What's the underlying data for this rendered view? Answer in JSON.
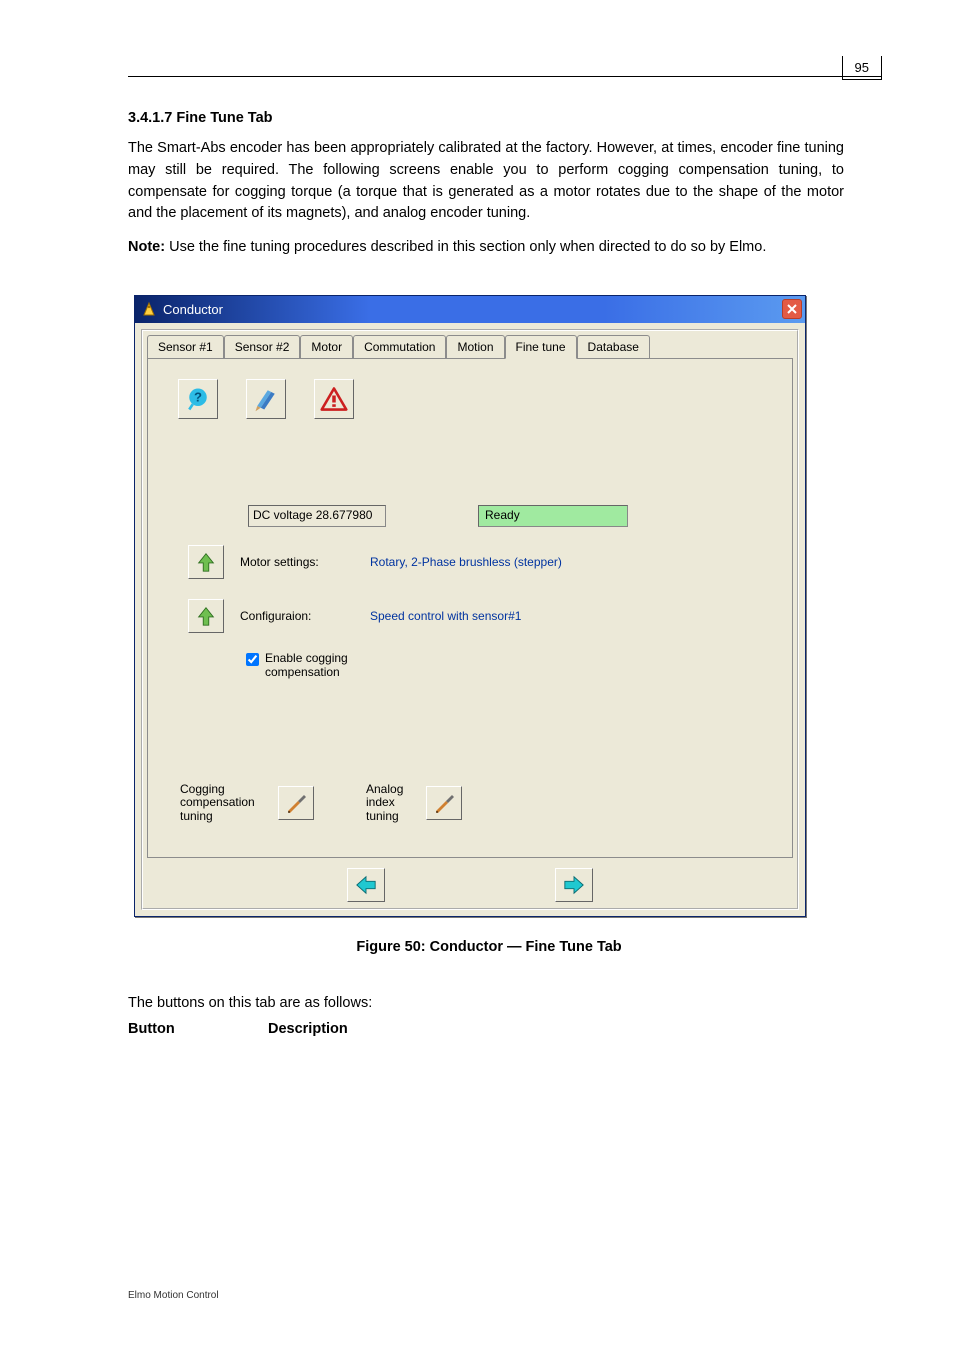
{
  "page_number": "95",
  "section_title": "3.4.1.7 Fine Tune Tab",
  "intro_para": "The Smart-Abs encoder has been appropriately calibrated at the factory. However, at times, encoder fine tuning may still be required. The following screens enable you to perform cogging compensation tuning, to compensate for cogging torque (a torque that is generated as a motor rotates due to the shape of the motor and the placement of its magnets), and analog encoder tuning.",
  "para_note_prefix": "Note:",
  "para_note": " Use the fine tuning procedures described in this section only when directed to do so by Elmo.",
  "window": {
    "title": "Conductor",
    "tabs": [
      "Sensor #1",
      "Sensor #2",
      "Motor",
      "Commutation",
      "Motion",
      "Fine tune",
      "Database"
    ],
    "active_tab": "Fine tune",
    "dc_voltage": "DC voltage 28.677980",
    "status": "Ready",
    "motor_settings_label": "Motor settings:",
    "motor_settings_value": "Rotary, 2-Phase brushless (stepper)",
    "config_label": "Configuraion:",
    "config_value": "Speed control with sensor#1",
    "enable_cogging": "Enable cogging compensation",
    "enable_cogging_checked": true,
    "cogging_tuning_label": "Cogging compensation tuning",
    "analog_tuning_label": "Analog index tuning"
  },
  "figure_caption": "Figure 50: Conductor — Fine Tune Tab",
  "button_desc": "The buttons on this tab are as follows:",
  "table_header_left": "Button",
  "table_header_right": "Description",
  "footer": "Elmo Motion Control",
  "icons": {
    "help": "help-icon",
    "crayon": "pencils-icon",
    "warning": "warning-icon",
    "uparrow": "up-arrow-icon",
    "screwdriver": "screwdriver-icon",
    "back": "back-arrow-icon",
    "next": "next-arrow-icon",
    "close": "close-icon",
    "title": "title-icon"
  }
}
